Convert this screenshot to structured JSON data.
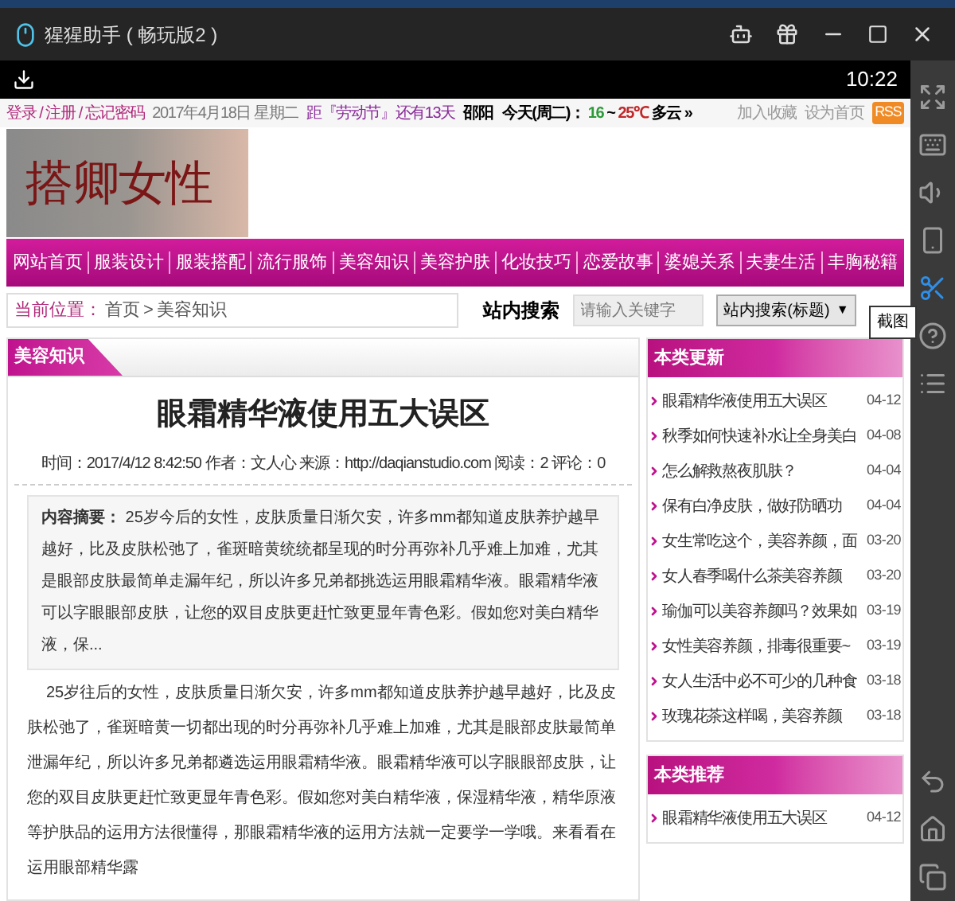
{
  "window": {
    "title": "猩猩助手 ( 畅玩版2 )"
  },
  "status_bar": {
    "time": "10:22"
  },
  "topbar": {
    "account_links": [
      "登录",
      "注册",
      "忘记密码"
    ],
    "separator": "/",
    "date": "2017年4月18日 星期二",
    "countdown": "距『劳动节』还有13天",
    "weather": {
      "city": "邵阳",
      "day": "今天(周二)：",
      "low": "16",
      "tilde": "~",
      "high": "25℃",
      "condition": "多云",
      "more": "»"
    },
    "right_links": [
      "加入收藏",
      "设为首页"
    ],
    "rss": "RSS"
  },
  "logo": {
    "text": "搭卿女性"
  },
  "nav": [
    "网站首页",
    "服装设计",
    "服装搭配",
    "流行服饰",
    "美容知识",
    "美容护肤",
    "化妆技巧",
    "恋爱故事",
    "婆媳关系",
    "夫妻生活",
    "丰胸秘籍"
  ],
  "breadcrumb": {
    "label": "当前位置",
    "colon": "：",
    "path": [
      "首页",
      "美容知识"
    ],
    "separator": ">"
  },
  "search": {
    "label": "站内搜索",
    "placeholder": "请输入关键字",
    "select": "站内搜索(标题)",
    "caret": "▼"
  },
  "tooltip": "截图",
  "article": {
    "category": "美容知识",
    "title": "眼霜精华液使用五大误区",
    "meta": "时间：2017/4/12 8:42:50  作者：文人心  来源：http://daqianstudio.com  阅读：2  评论：0",
    "summary_label": "内容摘要：",
    "summary": "25岁今后的女性，皮肤质量日渐欠安，许多mm都知道皮肤养护越早越好，比及皮肤松弛了，雀斑暗黄统统都呈现的时分再弥补几乎难上加难，尤其是眼部皮肤最简单走漏年纪，所以许多兄弟都挑选运用眼霜精华液。眼霜精华液可以字眼眼部皮肤，让您的双目皮肤更赶忙致更显年青色彩。假如您对美白精华液，保...",
    "body": "25岁往后的女性，皮肤质量日渐欠安，许多mm都知道皮肤养护越早越好，比及皮肤松弛了，雀斑暗黄一切都出现的时分再弥补几乎难上加难，尤其是眼部皮肤最简单泄漏年纪，所以许多兄弟都遴选运用眼霜精华液。眼霜精华液可以字眼眼部皮肤，让您的双目皮肤更赶忙致更显年青色彩。假如您对美白精华液，保湿精华液，精华原液等护肤品的运用方法很懂得，那眼霜精华液的运用方法就一定要学一学哦。来看看在运用眼部精华露"
  },
  "sidebar": [
    {
      "title": "本类更新",
      "items": [
        {
          "text": "眼霜精华液使用五大误区",
          "date": "04-12"
        },
        {
          "text": "秋季如何快速补水让全身美白",
          "date": "04-08"
        },
        {
          "text": "怎么解救熬夜肌肤？",
          "date": "04-04"
        },
        {
          "text": "保有白净皮肤，做好防晒功",
          "date": "04-04"
        },
        {
          "text": "女生常吃这个，美容养颜，面",
          "date": "03-20"
        },
        {
          "text": "女人春季喝什么茶美容养颜",
          "date": "03-20"
        },
        {
          "text": "瑜伽可以美容养颜吗？效果如",
          "date": "03-19"
        },
        {
          "text": "女性美容养颜，排毒很重要~",
          "date": "03-19"
        },
        {
          "text": "女人生活中必不可少的几种食",
          "date": "03-18"
        },
        {
          "text": "玫瑰花茶这样喝，美容养颜",
          "date": "03-18"
        }
      ]
    },
    {
      "title": "本类推荐",
      "items": [
        {
          "text": "眼霜精华液使用五大误区",
          "date": "04-12"
        }
      ]
    }
  ]
}
